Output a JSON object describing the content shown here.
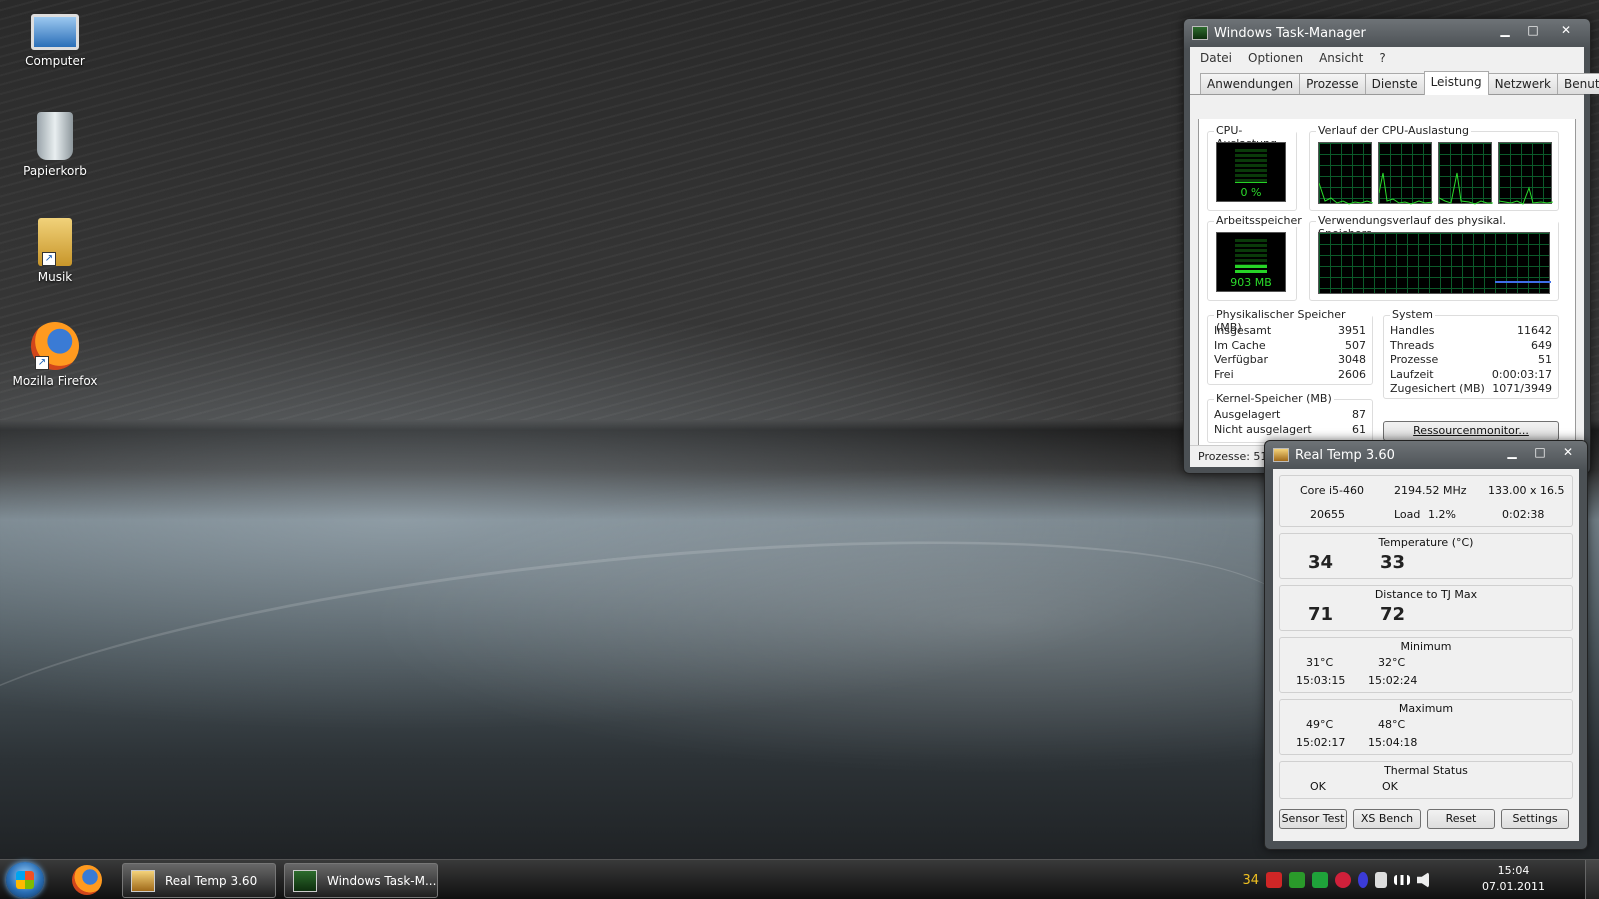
{
  "desktop": {
    "icons": [
      {
        "label": "Computer",
        "icon": "computer-icon"
      },
      {
        "label": "Papierkorb",
        "icon": "recycle-bin-icon"
      },
      {
        "label": "Musik",
        "icon": "music-folder-icon"
      },
      {
        "label": "Mozilla Firefox",
        "icon": "firefox-icon"
      }
    ]
  },
  "taskmanager": {
    "title": "Windows Task-Manager",
    "menu": [
      "Datei",
      "Optionen",
      "Ansicht",
      "?"
    ],
    "tabs": [
      "Anwendungen",
      "Prozesse",
      "Dienste",
      "Leistung",
      "Netzwerk",
      "Benutzer"
    ],
    "active_tab": "Leistung",
    "cpu_usage": {
      "title": "CPU-Auslastung",
      "value": "0 %",
      "level": 0.0
    },
    "cpu_history": {
      "title": "Verlauf der CPU-Auslastung",
      "cores": 4
    },
    "memory": {
      "title": "Arbeitsspeicher",
      "value": "903 MB",
      "level": 0.23
    },
    "memory_history": {
      "title": "Verwendungsverlauf des physikal. Speichers"
    },
    "physical": {
      "title": "Physikalischer Speicher (MB)",
      "rows": [
        {
          "label": "Insgesamt",
          "value": "3951"
        },
        {
          "label": "Im Cache",
          "value": "507"
        },
        {
          "label": "Verfügbar",
          "value": "3048"
        },
        {
          "label": "Frei",
          "value": "2606"
        }
      ]
    },
    "kernel": {
      "title": "Kernel-Speicher (MB)",
      "rows": [
        {
          "label": "Ausgelagert",
          "value": "87"
        },
        {
          "label": "Nicht ausgelagert",
          "value": "61"
        }
      ]
    },
    "system": {
      "title": "System",
      "rows": [
        {
          "label": "Handles",
          "value": "11642"
        },
        {
          "label": "Threads",
          "value": "649"
        },
        {
          "label": "Prozesse",
          "value": "51"
        },
        {
          "label": "Laufzeit",
          "value": "0:00:03:17"
        },
        {
          "label": "Zugesichert (MB)",
          "value": "1071/3949"
        }
      ]
    },
    "resource_button": "Ressourcenmonitor...",
    "status": "Prozesse: 51"
  },
  "realtemp": {
    "title": "Real Temp 3.60",
    "cpu": "Core i5-460",
    "freq": "2194.52 MHz",
    "multiplier": "133.00 x 16.5",
    "id": "20655",
    "load_label": "Load",
    "load": "1.2%",
    "uptime": "0:02:38",
    "temperature": {
      "label": "Temperature (°C)",
      "core0": "34",
      "core1": "33"
    },
    "distance": {
      "label": "Distance to TJ Max",
      "core0": "71",
      "core1": "72"
    },
    "minimum": {
      "label": "Minimum",
      "core0": "31°C",
      "core1": "32°C",
      "time0": "15:03:15",
      "time1": "15:02:24"
    },
    "maximum": {
      "label": "Maximum",
      "core0": "49°C",
      "core1": "48°C",
      "time0": "15:02:17",
      "time1": "15:04:18"
    },
    "thermal": {
      "label": "Thermal Status",
      "core0": "OK",
      "core1": "OK"
    },
    "buttons": [
      "Sensor Test",
      "XS Bench",
      "Reset",
      "Settings"
    ]
  },
  "taskbar": {
    "items": [
      {
        "label": "Real Temp 3.60"
      },
      {
        "label": "Windows Task-M..."
      }
    ],
    "tray_temp": "34",
    "time": "15:04",
    "date": "07.01.2011"
  },
  "colors": {
    "graph_green": "#2bdc2b",
    "grid": "#0b5a2a",
    "memory_line": "#3f6ee8"
  }
}
